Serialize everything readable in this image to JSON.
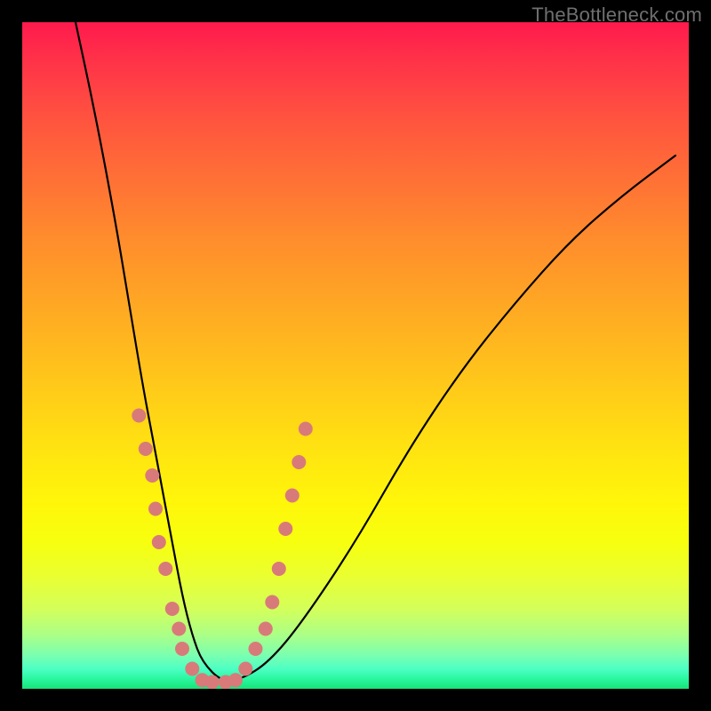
{
  "watermark": "TheBottleneck.com",
  "chart_data": {
    "type": "line",
    "title": "",
    "xlabel": "",
    "ylabel": "",
    "xlim": [
      0,
      100
    ],
    "ylim": [
      0,
      100
    ],
    "series": [
      {
        "name": "bottleneck-curve",
        "x": [
          8,
          11,
          14,
          16,
          18,
          19.5,
          21,
          22.5,
          24,
          25.5,
          27,
          30,
          33,
          37,
          42,
          50,
          58,
          66,
          74,
          82,
          90,
          98
        ],
        "y": [
          100,
          86,
          70,
          58,
          46,
          38,
          30,
          22,
          14,
          8,
          4,
          1,
          1.5,
          4,
          10,
          22,
          36,
          48,
          58,
          67,
          74,
          80
        ]
      }
    ],
    "markers": {
      "name": "sample-points",
      "points": [
        {
          "x": 17.5,
          "y": 41
        },
        {
          "x": 18.5,
          "y": 36
        },
        {
          "x": 19.5,
          "y": 32
        },
        {
          "x": 20.0,
          "y": 27
        },
        {
          "x": 20.5,
          "y": 22
        },
        {
          "x": 21.5,
          "y": 18
        },
        {
          "x": 22.5,
          "y": 12
        },
        {
          "x": 23.5,
          "y": 9
        },
        {
          "x": 24.0,
          "y": 6
        },
        {
          "x": 25.5,
          "y": 3
        },
        {
          "x": 27.0,
          "y": 1.3
        },
        {
          "x": 28.5,
          "y": 1.0
        },
        {
          "x": 30.5,
          "y": 1.0
        },
        {
          "x": 32.0,
          "y": 1.3
        },
        {
          "x": 33.5,
          "y": 3
        },
        {
          "x": 35.0,
          "y": 6
        },
        {
          "x": 36.5,
          "y": 9
        },
        {
          "x": 37.5,
          "y": 13
        },
        {
          "x": 38.5,
          "y": 18
        },
        {
          "x": 39.5,
          "y": 24
        },
        {
          "x": 40.5,
          "y": 29
        },
        {
          "x": 41.5,
          "y": 34
        },
        {
          "x": 42.5,
          "y": 39
        }
      ]
    },
    "colors": {
      "curve": "#000000",
      "marker": "#d97a7a",
      "gradient_top": "#ff1a4d",
      "gradient_bottom": "#18e478"
    }
  }
}
